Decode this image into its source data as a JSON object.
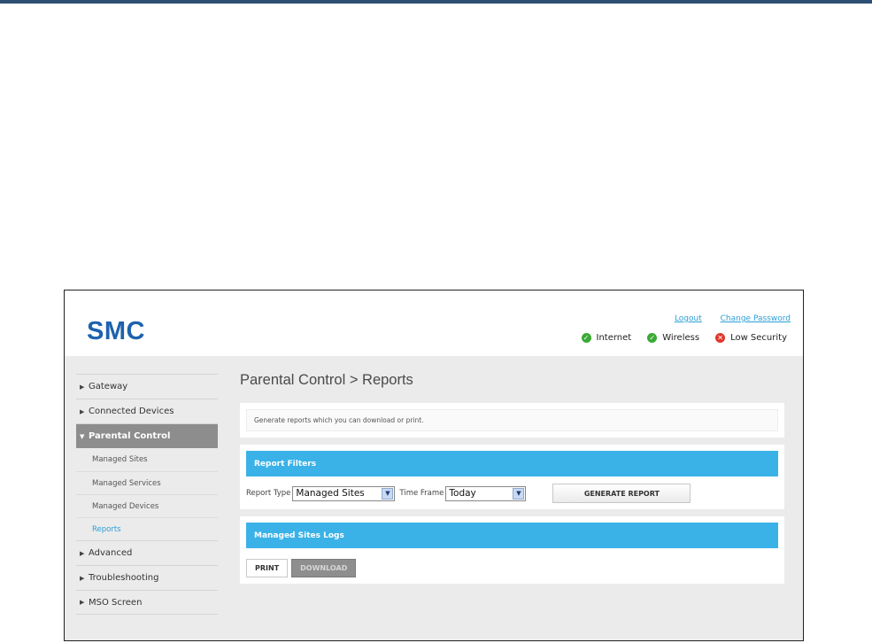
{
  "header": {
    "logo": "SMC",
    "links": {
      "logout": "Logout",
      "change_password": "Change Password"
    },
    "status": [
      {
        "label": "Internet",
        "state": "ok"
      },
      {
        "label": "Wireless",
        "state": "ok"
      },
      {
        "label": "Low Security",
        "state": "bad"
      }
    ]
  },
  "sidebar": {
    "items": [
      {
        "label": "Gateway"
      },
      {
        "label": "Connected Devices"
      },
      {
        "label": "Parental Control",
        "expanded": true
      },
      {
        "label": "Advanced"
      },
      {
        "label": "Troubleshooting"
      },
      {
        "label": "MSO Screen"
      }
    ],
    "sub_items": [
      {
        "label": "Managed Sites"
      },
      {
        "label": "Managed Services"
      },
      {
        "label": "Managed Devices"
      },
      {
        "label": "Reports",
        "current": true
      }
    ]
  },
  "main": {
    "title": "Parental Control > Reports",
    "description": "Generate reports which you can download or print.",
    "filters": {
      "heading": "Report Filters",
      "report_type_label": "Report Type",
      "report_type_value": "Managed Sites",
      "time_frame_label": "Time Frame",
      "time_frame_value": "Today",
      "generate_label": "GENERATE REPORT"
    },
    "logs": {
      "heading": "Managed Sites Logs",
      "print_label": "PRINT",
      "download_label": "DOWNLOAD"
    }
  },
  "colors": {
    "brand": "#1d62ad",
    "accent": "#3ab2e8",
    "link": "#2b9fd8",
    "ok": "#3aaa35",
    "bad": "#e0382b"
  }
}
